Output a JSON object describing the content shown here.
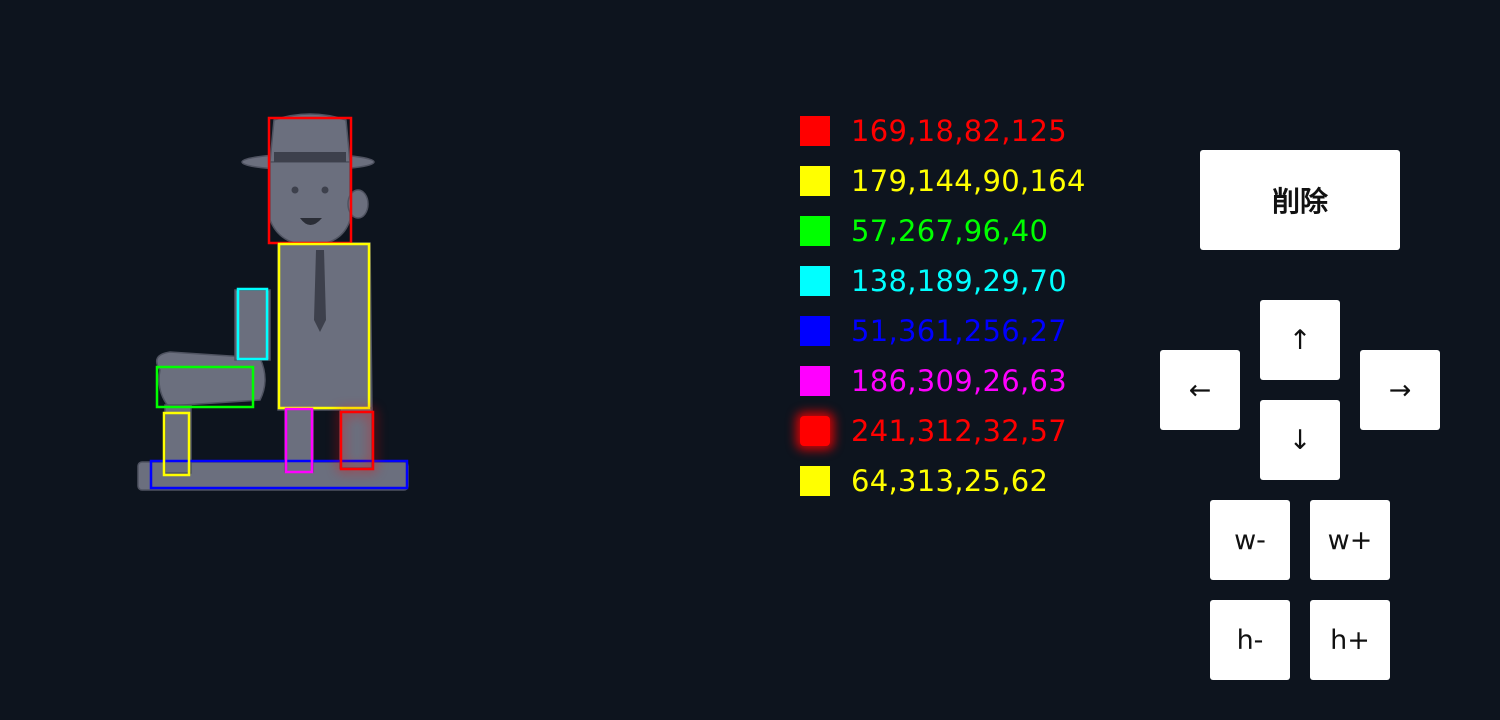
{
  "legend": [
    {
      "label": "169,18,82,125",
      "color": "#ff0000"
    },
    {
      "label": "179,144,90,164",
      "color": "#ffff00"
    },
    {
      "label": "57,267,96,40",
      "color": "#00ff00"
    },
    {
      "label": "138,189,29,70",
      "color": "#00ffff"
    },
    {
      "label": "51,361,256,27",
      "color": "#0000ff"
    },
    {
      "label": "186,309,26,63",
      "color": "#ff00ff"
    },
    {
      "label": "241,312,32,57",
      "color": "#ff0000",
      "selected": true
    },
    {
      "label": "64,313,25,62",
      "color": "#ffff00"
    }
  ],
  "buttons": {
    "delete": "削除",
    "up": "↑",
    "left": "←",
    "right": "→",
    "down": "↓",
    "w_minus": "w-",
    "w_plus": "w+",
    "h_minus": "h-",
    "h_plus": "h+"
  },
  "image": {
    "subject": "statue-illustration",
    "fill_color": "#6b6f7e"
  }
}
